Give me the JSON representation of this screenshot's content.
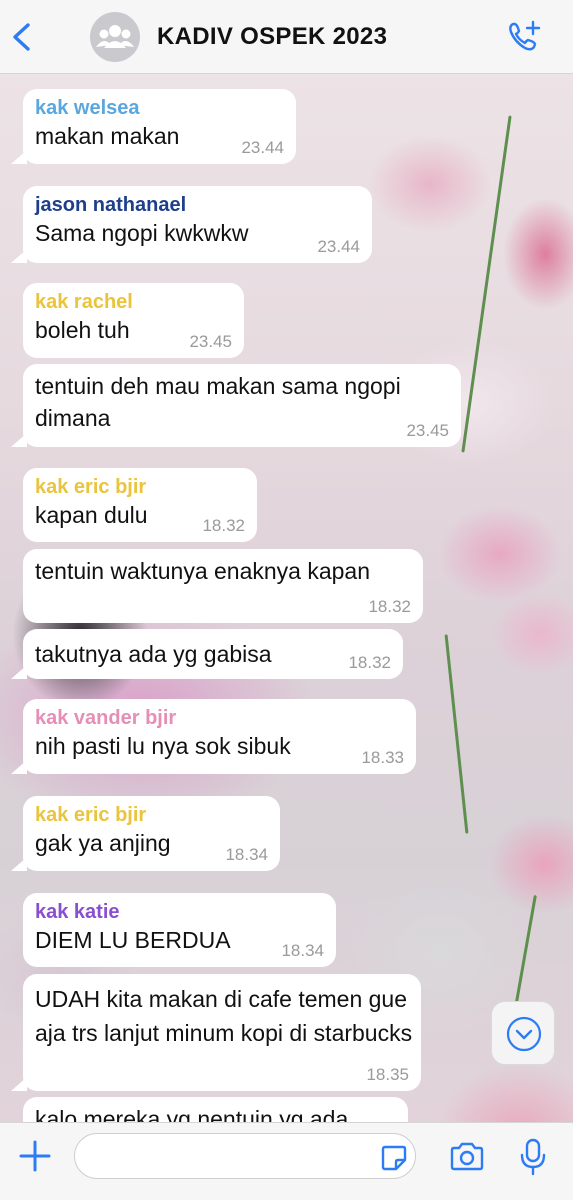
{
  "header": {
    "title": "KADIV OSPEK 2023",
    "icons": {
      "back": "chevron-left-icon",
      "avatar": "group-avatar-icon",
      "call": "add-call-icon"
    }
  },
  "colors": {
    "accent": "#2c7cf6",
    "kak_welsea": "#5aa7e0",
    "jason_nathanael": "#1e3f8a",
    "kak_rachel": "#e9c43c",
    "kak_eric_bjir": "#e9c43c",
    "kak_vander_bjir": "#e58fb6",
    "kak_katie": "#8a4fd1"
  },
  "messages": [
    {
      "sender": "kak welsea",
      "text": "makan makan",
      "time": "23.44"
    },
    {
      "sender": "jason nathanael",
      "text": "Sama ngopi kwkwkw",
      "time": "23.44"
    },
    {
      "sender": "kak rachel",
      "text": "boleh tuh",
      "time": "23.45"
    },
    {
      "sender": "",
      "text": "tentuin deh mau makan sama ngopi dimana",
      "time": "23.45"
    },
    {
      "sender": "kak eric bjir",
      "text": "kapan dulu",
      "time": "18.32"
    },
    {
      "sender": "",
      "text": "tentuin waktunya enaknya kapan",
      "time": "18.32"
    },
    {
      "sender": "",
      "text": "takutnya ada yg gabisa",
      "time": "18.32"
    },
    {
      "sender": "kak vander bjir",
      "text": "nih pasti lu nya sok sibuk",
      "time": "18.33"
    },
    {
      "sender": "kak eric bjir",
      "text": "gak ya anjing",
      "time": "18.34"
    },
    {
      "sender": "kak katie",
      "text": "DIEM LU BERDUA",
      "time": "18.34"
    },
    {
      "sender": "",
      "text": "UDAH kita makan di cafe temen gue aja trs lanjut minum kopi di starbucks",
      "time": "18.35"
    },
    {
      "sender": "",
      "text": "kalo mereka yg nentuin yg ada",
      "time": ""
    }
  ],
  "input": {
    "placeholder": ""
  },
  "icons": {
    "scroll_down": "chevron-down-circle-icon",
    "plus": "plus-icon",
    "sticker": "sticker-icon",
    "camera": "camera-icon",
    "mic": "mic-icon"
  }
}
